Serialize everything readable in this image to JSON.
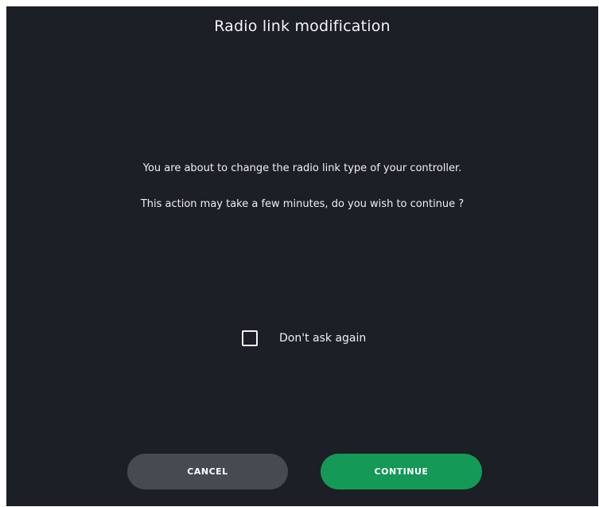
{
  "dialog": {
    "title": "Radio link modification",
    "message_line1": "You are about to change the radio link type of your controller.",
    "message_line2": "This action may take a few minutes, do you wish to continue ?",
    "dont_ask": {
      "label": "Don't ask again",
      "checked": false
    },
    "cancel_label": "CANCEL",
    "continue_label": "CONTINUE"
  },
  "colors": {
    "background": "#1c1f25",
    "cancel_button": "#464a51",
    "continue_button": "#149957",
    "text": "#eef0f2"
  }
}
